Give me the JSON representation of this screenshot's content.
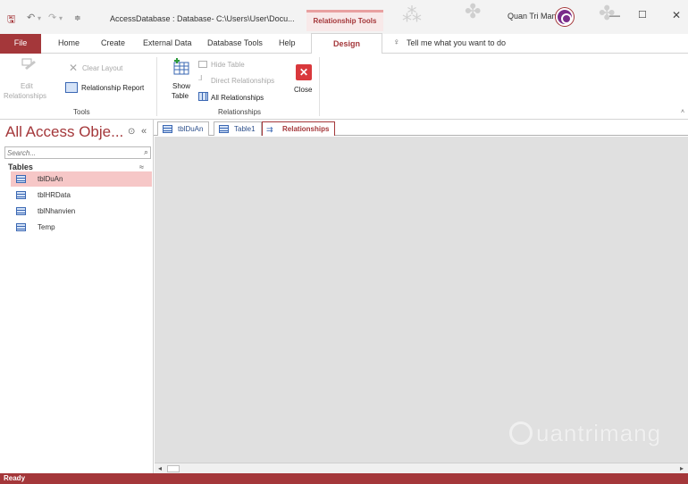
{
  "titlebar": {
    "title": "AccessDatabase : Database- C:\\Users\\User\\Docu...",
    "context_tab": "Relationship Tools",
    "user": "Quan Tri Mang"
  },
  "ribbon_tabs": [
    "File",
    "Home",
    "Create",
    "External Data",
    "Database Tools",
    "Help",
    "Design"
  ],
  "tell_me": "Tell me what you want to do",
  "ribbon": {
    "tools": {
      "edit_line1": "Edit",
      "edit_line2": "Relationships",
      "clear_layout": "Clear Layout",
      "relationship_report": "Relationship Report",
      "label": "Tools"
    },
    "relationships": {
      "show_line1": "Show",
      "show_line2": "Table",
      "hide_table": "Hide Table",
      "direct_relationships": "Direct Relationships",
      "all_relationships": "All Relationships",
      "close": "Close",
      "label": "Relationships"
    }
  },
  "nav": {
    "title": "All Access Obje...",
    "search_placeholder": "Search...",
    "section": "Tables",
    "items": [
      "tblDuAn",
      "tblHRData",
      "tblNhanvien",
      "Temp"
    ]
  },
  "doc_tabs": [
    "tblDuAn",
    "Table1",
    "Relationships"
  ],
  "status": "Ready",
  "watermark": "uantrimang",
  "colors": {
    "accent": "#a4373a",
    "selected_item": "#f6c7c7",
    "work_area": "#e0e0e0"
  }
}
